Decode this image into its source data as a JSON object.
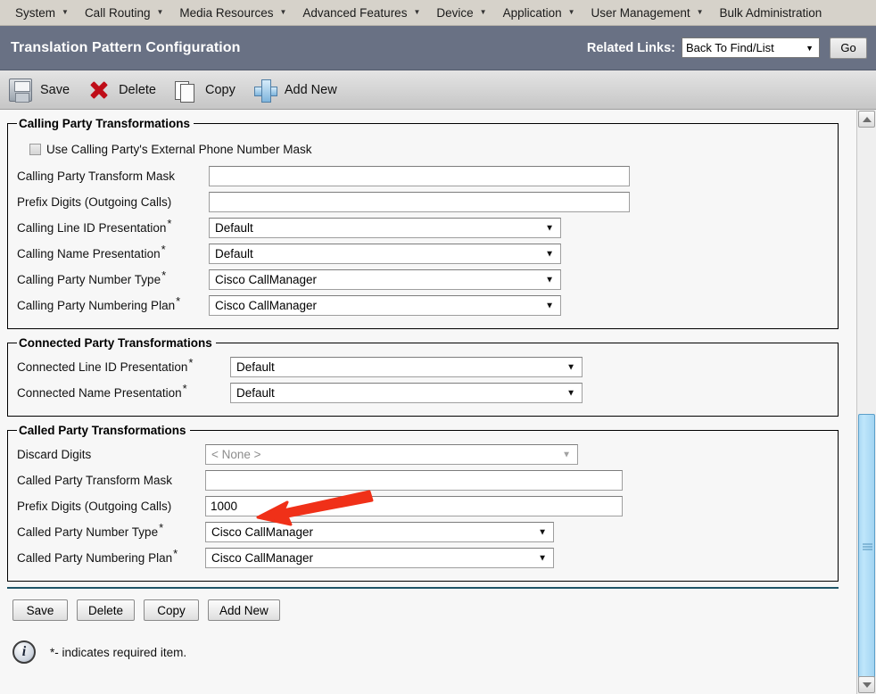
{
  "menubar": {
    "items": [
      {
        "label": "System",
        "has_caret": true,
        "icon": "chevron-down-icon"
      },
      {
        "label": "Call Routing",
        "has_caret": true,
        "icon": "chevron-down-icon"
      },
      {
        "label": "Media Resources",
        "has_caret": true,
        "icon": "chevron-down-icon"
      },
      {
        "label": "Advanced Features",
        "has_caret": true,
        "icon": "chevron-down-icon"
      },
      {
        "label": "Device",
        "has_caret": true,
        "icon": "chevron-down-icon"
      },
      {
        "label": "Application",
        "has_caret": true,
        "icon": "chevron-down-icon"
      },
      {
        "label": "User Management",
        "has_caret": true,
        "icon": "chevron-down-icon"
      },
      {
        "label": "Bulk Administration",
        "has_caret": false,
        "icon": ""
      }
    ]
  },
  "header": {
    "title": "Translation Pattern Configuration",
    "related_links_label": "Related Links:",
    "related_links_value": "Back To Find/List",
    "go_label": "Go",
    "bar_color": "#697184"
  },
  "toolbar": {
    "buttons": [
      {
        "label": "Save",
        "icon": "floppy-disk-save-icon"
      },
      {
        "label": "Delete",
        "icon": "red-x-delete-icon"
      },
      {
        "label": "Copy",
        "icon": "two-pages-copy-icon"
      },
      {
        "label": "Add New",
        "icon": "blue-plus-add-icon"
      }
    ]
  },
  "calling_party": {
    "legend": "Calling Party Transformations",
    "checkbox_label": "Use Calling Party's External Phone Number Mask",
    "checkbox_checked": false,
    "fields": [
      {
        "label": "Calling Party Transform Mask",
        "required": false,
        "type": "text",
        "value": ""
      },
      {
        "label": "Prefix Digits (Outgoing Calls)",
        "required": false,
        "type": "text",
        "value": ""
      },
      {
        "label": "Calling Line ID Presentation",
        "required": true,
        "type": "select",
        "value": "Default"
      },
      {
        "label": "Calling Name Presentation",
        "required": true,
        "type": "select",
        "value": "Default"
      },
      {
        "label": "Calling Party Number Type",
        "required": true,
        "type": "select",
        "value": "Cisco CallManager"
      },
      {
        "label": "Calling Party Numbering Plan",
        "required": true,
        "type": "select",
        "value": "Cisco CallManager"
      }
    ]
  },
  "connected_party": {
    "legend": "Connected Party Transformations",
    "fields": [
      {
        "label": "Connected Line ID Presentation",
        "required": true,
        "type": "select",
        "value": "Default"
      },
      {
        "label": "Connected Name Presentation",
        "required": true,
        "type": "select",
        "value": "Default"
      }
    ]
  },
  "called_party": {
    "legend": "Called Party Transformations",
    "fields": [
      {
        "label": "Discard Digits",
        "required": false,
        "type": "select",
        "value": "< None >",
        "disabled": true
      },
      {
        "label": "Called Party Transform Mask",
        "required": false,
        "type": "text",
        "value": ""
      },
      {
        "label": "Prefix Digits (Outgoing Calls)",
        "required": false,
        "type": "text",
        "value": "1000"
      },
      {
        "label": "Called Party Number Type",
        "required": true,
        "type": "select",
        "value": "Cisco CallManager"
      },
      {
        "label": "Called Party Numbering Plan",
        "required": true,
        "type": "select",
        "value": "Cisco CallManager"
      }
    ]
  },
  "footer": {
    "buttons": [
      {
        "label": "Save"
      },
      {
        "label": "Delete"
      },
      {
        "label": "Copy"
      },
      {
        "label": "Add New"
      }
    ],
    "note": "*- indicates required item.",
    "note_icon": "info-circle-icon"
  },
  "annotation": {
    "type": "arrow",
    "color": "#f03018",
    "points_to": "Prefix Digits (Outgoing Calls) value 1000"
  },
  "scrollbar": {
    "up_icon": "scroll-up-arrow-icon",
    "down_icon": "scroll-down-arrow-icon",
    "thumb_color": "#a9d9f5"
  }
}
